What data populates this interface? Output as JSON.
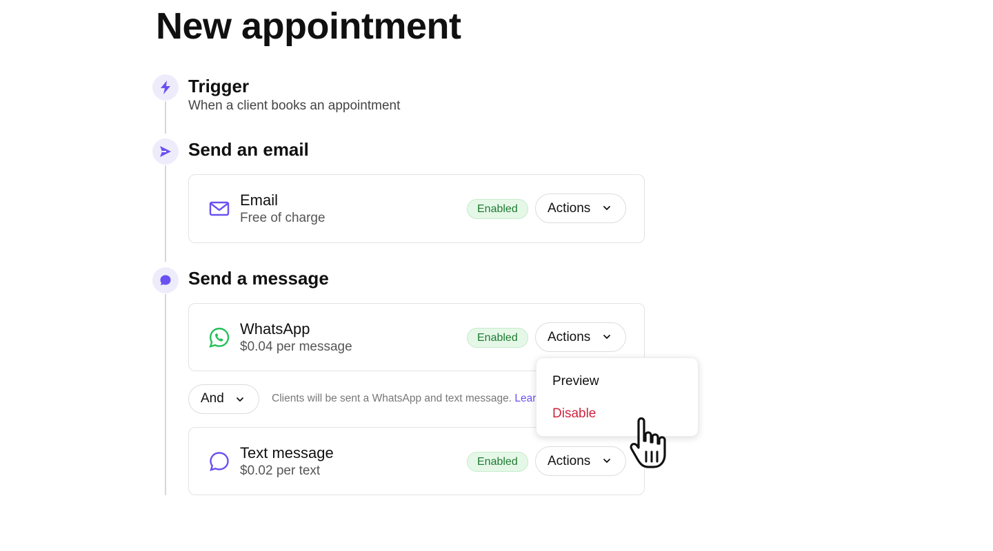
{
  "page": {
    "title": "New appointment"
  },
  "steps": {
    "trigger": {
      "title": "Trigger",
      "subtitle": "When a client books an appointment",
      "icon": "lightning-icon"
    },
    "email_step": {
      "title": "Send an email",
      "icon": "send-icon"
    },
    "message_step": {
      "title": "Send a message",
      "icon": "chat-bubble-icon"
    }
  },
  "cards": {
    "email": {
      "title": "Email",
      "subtitle": "Free of charge",
      "badge": "Enabled",
      "actions_label": "Actions",
      "icon": "envelope-icon"
    },
    "whatsapp": {
      "title": "WhatsApp",
      "subtitle": "$0.04 per message",
      "badge": "Enabled",
      "actions_label": "Actions",
      "icon": "whatsapp-icon"
    },
    "text": {
      "title": "Text message",
      "subtitle": "$0.02 per text",
      "badge": "Enabled",
      "actions_label": "Actions",
      "icon": "message-bubble-icon"
    }
  },
  "combinator": {
    "label": "And",
    "note": "Clients will be sent a WhatsApp and text message.",
    "learn_more": "Learn"
  },
  "dropdown": {
    "items": [
      {
        "label": "Preview"
      },
      {
        "label": "Disable"
      }
    ]
  },
  "colors": {
    "accent": "#6950f3",
    "badge_bg": "#e5f8e8",
    "badge_text": "#1e7a2f",
    "whatsapp_green": "#25c05a",
    "danger": "#d0243d"
  }
}
